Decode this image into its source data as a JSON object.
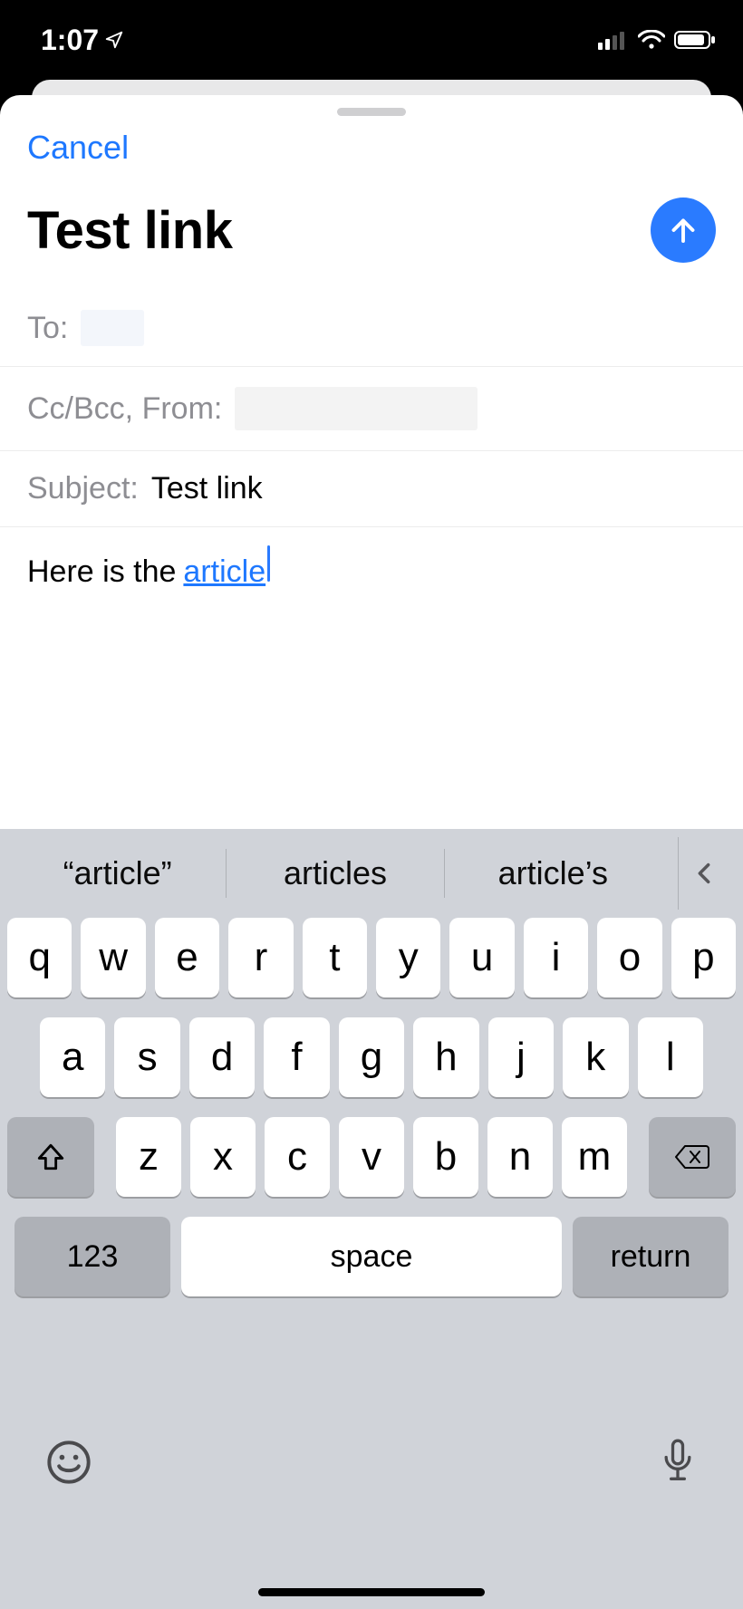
{
  "statusbar": {
    "time": "1:07"
  },
  "compose": {
    "cancel_label": "Cancel",
    "title": "Test link",
    "to_label": "To:",
    "ccbcc_label": "Cc/Bcc, From:",
    "subject_label": "Subject:",
    "subject_value": "Test link",
    "body_prefix": "Here is the ",
    "body_link_text": "article"
  },
  "keyboard": {
    "suggestions": [
      "“article”",
      "articles",
      "article’s"
    ],
    "row1": [
      "q",
      "w",
      "e",
      "r",
      "t",
      "y",
      "u",
      "i",
      "o",
      "p"
    ],
    "row2": [
      "a",
      "s",
      "d",
      "f",
      "g",
      "h",
      "j",
      "k",
      "l"
    ],
    "row3": [
      "z",
      "x",
      "c",
      "v",
      "b",
      "n",
      "m"
    ],
    "numkey_label": "123",
    "space_label": "space",
    "return_label": "return"
  }
}
